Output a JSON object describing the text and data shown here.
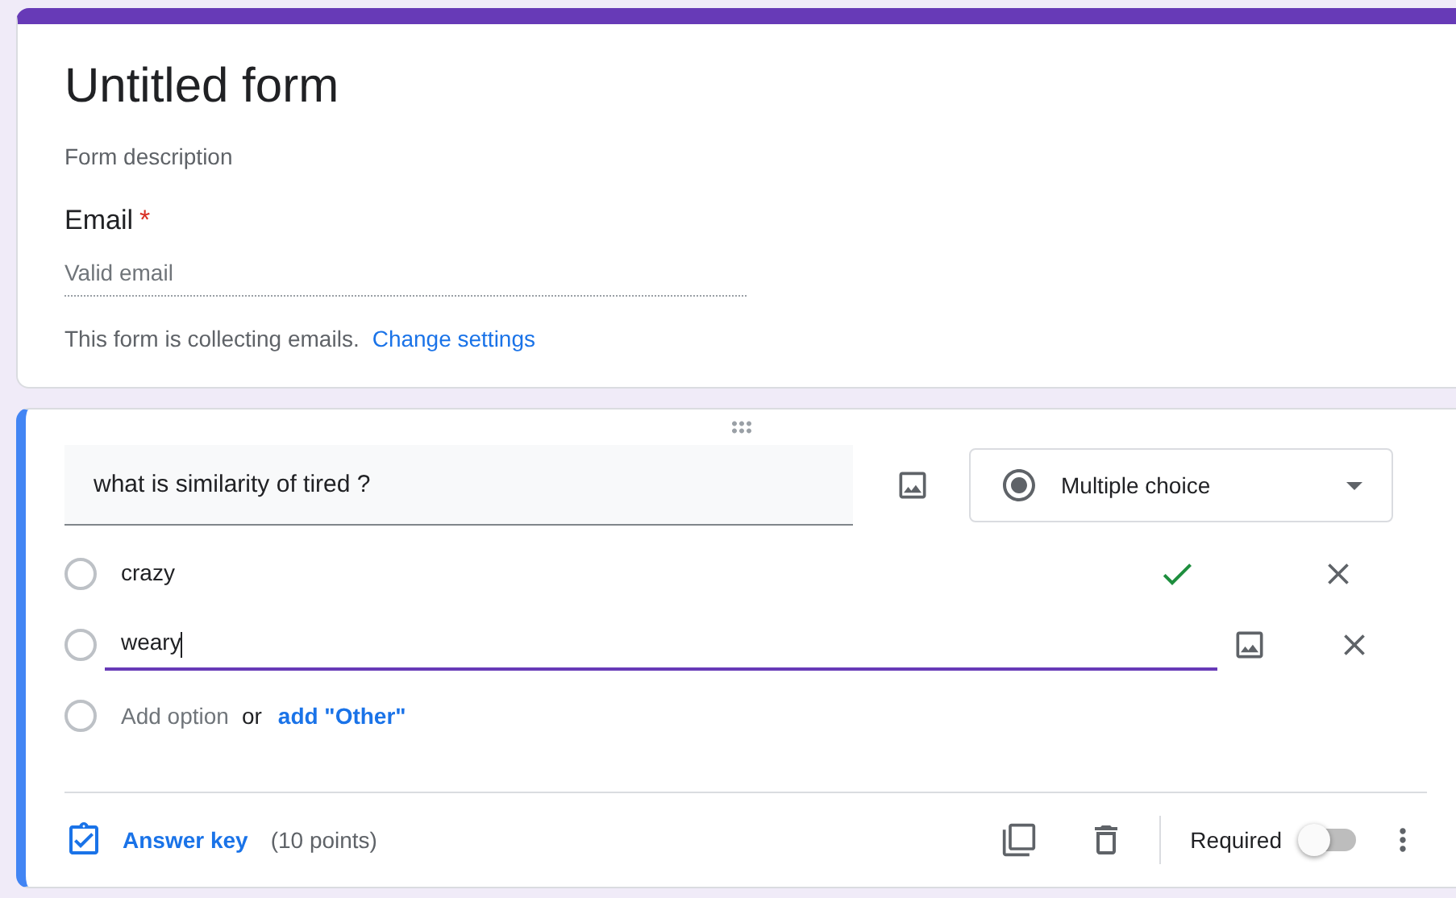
{
  "header": {
    "title": "Untitled form",
    "description": "Form description",
    "email_label": "Email",
    "required_mark": "*",
    "email_placeholder": "Valid email",
    "notice": "This form is collecting emails.",
    "notice_link": "Change settings"
  },
  "question": {
    "title": "what is similarity of tired ?",
    "type": "Multiple choice",
    "options": [
      {
        "kind": "option",
        "label": "crazy",
        "checked": false,
        "correct": true,
        "editing": false
      },
      {
        "kind": "option",
        "label": "weary",
        "checked": false,
        "correct": false,
        "editing": true
      },
      {
        "kind": "add",
        "checked": false,
        "label": "Add option",
        "joiner": "or",
        "link": "add \"Other\""
      }
    ],
    "answer_key": "Answer key",
    "points": "(10 points)",
    "required_label": "Required",
    "required_on": false
  }
}
